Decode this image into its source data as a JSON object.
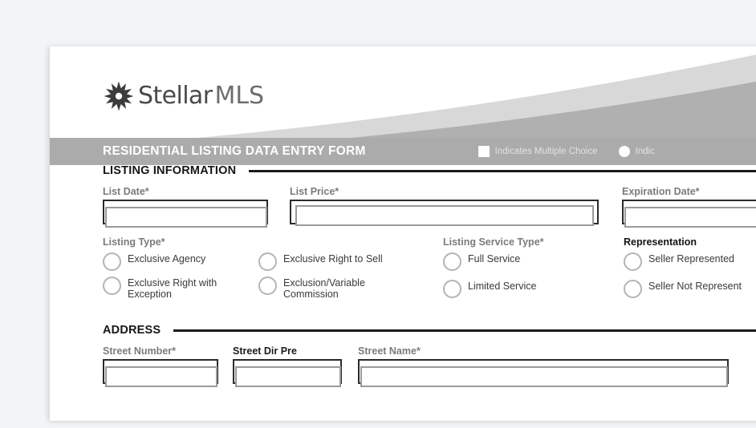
{
  "brand": {
    "logo_icon": "starburst-icon",
    "name_primary": "Stellar",
    "name_secondary": "MLS"
  },
  "header": {
    "title": "RESIDENTIAL LISTING DATA ENTRY FORM",
    "legend": [
      {
        "shape": "square",
        "icon": "square-swatch-icon",
        "text": "Indicates Multiple Choice"
      },
      {
        "shape": "circle",
        "icon": "circle-swatch-icon",
        "text": "Indic"
      }
    ]
  },
  "sections": [
    {
      "heading": "LISTING INFORMATION",
      "fields": [
        {
          "label": "List Date*",
          "value": ""
        },
        {
          "label": "List Price*",
          "value": ""
        },
        {
          "label": "Expiration Date*",
          "value": ""
        }
      ],
      "choice_groups": [
        {
          "title": "Listing Type*",
          "options_col1": [
            "Exclusive Agency",
            "Exclusive Right with Exception"
          ],
          "options_col2": [
            "Exclusive Right to Sell",
            "Exclusion/Variable Commission"
          ]
        },
        {
          "title": "Listing Service Type*",
          "options_col1": [
            "Full Service",
            "Limited Service"
          ]
        },
        {
          "title": "Representation",
          "options_col1": [
            "Seller Represented",
            "Seller Not Represent"
          ]
        }
      ]
    },
    {
      "heading": "ADDRESS",
      "fields": [
        {
          "label": "Street Number*",
          "value": ""
        },
        {
          "label": "Street Dir Pre",
          "value": ""
        },
        {
          "label": "Street Name*",
          "value": ""
        }
      ]
    }
  ],
  "colors": {
    "page_background": "#f2f4f6",
    "sheet": "#ffffff",
    "title_bar": "#ababab",
    "swoosh_light": "#d8d8d8",
    "swoosh_dark": "#b0b0b0",
    "label_gray": "#7b7b7b",
    "rule_dark": "#1b1b1b"
  }
}
